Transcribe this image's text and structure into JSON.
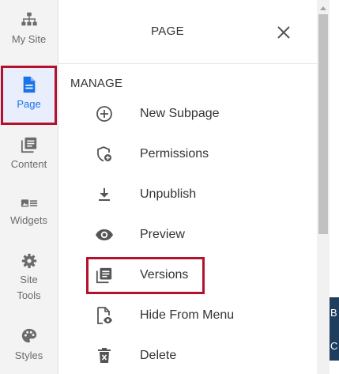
{
  "rail": {
    "items": [
      {
        "label": "My Site",
        "icon": "sitemap-icon"
      },
      {
        "label": "Page",
        "icon": "page-icon"
      },
      {
        "label": "Content",
        "icon": "content-icon"
      },
      {
        "label": "Widgets",
        "icon": "widgets-icon"
      },
      {
        "label": "Site Tools",
        "label_line1": "Site",
        "label_line2": "Tools",
        "icon": "gear-icon"
      },
      {
        "label": "Styles",
        "icon": "palette-icon"
      }
    ],
    "active": "Page"
  },
  "panel": {
    "title": "PAGE",
    "section_title": "MANAGE",
    "items": [
      {
        "label": "New Subpage",
        "icon": "plus-circle-icon"
      },
      {
        "label": "Permissions",
        "icon": "shield-add-icon"
      },
      {
        "label": "Unpublish",
        "icon": "download-icon"
      },
      {
        "label": "Preview",
        "icon": "eye-icon"
      },
      {
        "label": "Versions",
        "icon": "versions-icon"
      },
      {
        "label": "Hide From Menu",
        "icon": "file-eye-icon"
      },
      {
        "label": "Delete",
        "icon": "trash-icon"
      }
    ]
  },
  "background": {
    "letters": [
      "B",
      "C"
    ]
  },
  "colors": {
    "accent": "#1a73e8",
    "highlight": "#b4122c",
    "rail_bg": "#f3f3f3",
    "icon_gray": "#6b6b6b"
  }
}
